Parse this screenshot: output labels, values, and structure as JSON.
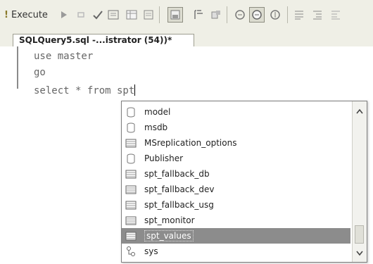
{
  "toolbar": {
    "execute_bang": "!",
    "execute_label": "Execute",
    "buttons": [
      "play-icon",
      "stop-icon",
      "check-icon",
      "parse-icon",
      "results-grid-icon",
      "results-file-icon",
      "include-plan-icon",
      "query-options-icon",
      "results-text-icon",
      "results-grid-toggle-icon",
      "display-plan-icon",
      "comment-icon",
      "indent-icon"
    ]
  },
  "tab": {
    "title": "SQLQuery5.sql -...istrator (54))*"
  },
  "editor": {
    "lines": [
      "use master",
      "go",
      "select * from spt"
    ]
  },
  "autocomplete": {
    "items": [
      {
        "label": "model",
        "icon": "database-icon"
      },
      {
        "label": "msdb",
        "icon": "database-icon"
      },
      {
        "label": "MSreplication_options",
        "icon": "table-icon"
      },
      {
        "label": "Publisher",
        "icon": "database-icon"
      },
      {
        "label": "spt_fallback_db",
        "icon": "table-icon"
      },
      {
        "label": "spt_fallback_dev",
        "icon": "table-icon"
      },
      {
        "label": "spt_fallback_usg",
        "icon": "table-icon"
      },
      {
        "label": "spt_monitor",
        "icon": "table-icon"
      },
      {
        "label": "spt_values",
        "icon": "table-icon",
        "selected": true
      },
      {
        "label": "sys",
        "icon": "schema-icon"
      }
    ]
  },
  "colors": {
    "selection": "#8c8c8c",
    "toolbar_bg": "#efefe6"
  }
}
